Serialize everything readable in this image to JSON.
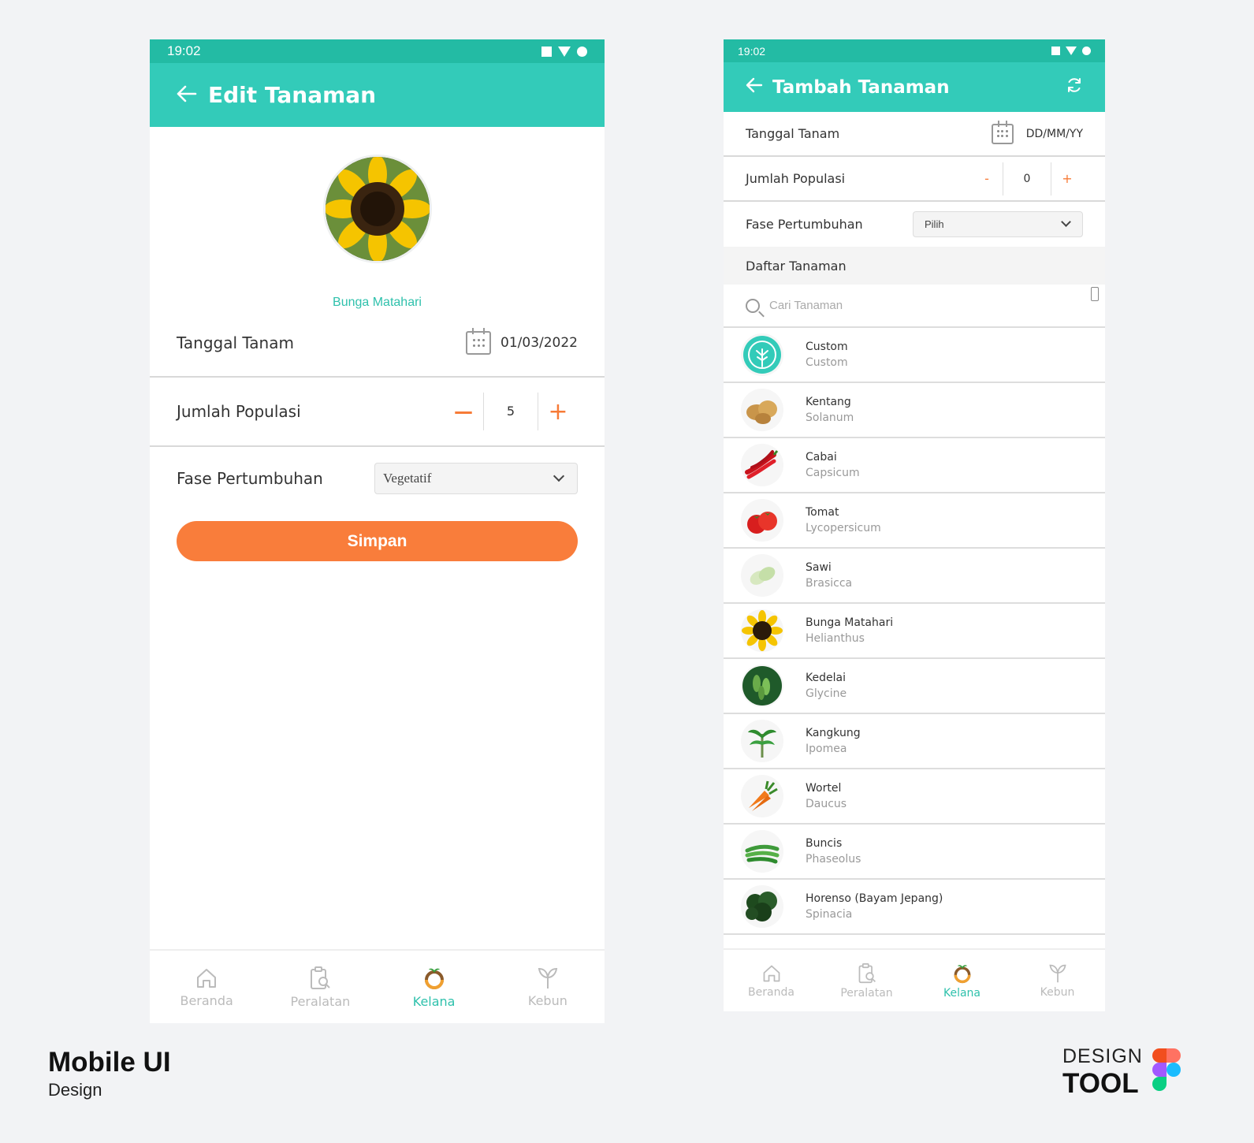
{
  "colors": {
    "teal": "#33cbb9",
    "teal_dark": "#23bba4",
    "orange": "#f97d3b",
    "accent_text": "#2fc1ac"
  },
  "edit_screen": {
    "status_time": "19:02",
    "title": "Edit Tanaman",
    "plant_name": "Bunga Matahari",
    "tanggal_label": "Tanggal Tanam",
    "tanggal_value": "01/03/2022",
    "populasi_label": "Jumlah Populasi",
    "populasi_minus": "—",
    "populasi_value": "5",
    "populasi_plus": "+",
    "fase_label": "Fase Pertumbuhan",
    "fase_value": "Vegetatif",
    "save_label": "Simpan"
  },
  "add_screen": {
    "status_time": "19:02",
    "title": "Tambah Tanaman",
    "tanggal_label": "Tanggal Tanam",
    "tanggal_placeholder": "DD/MM/YY",
    "populasi_label": "Jumlah Populasi",
    "populasi_minus": "-",
    "populasi_value": "0",
    "populasi_plus": "+",
    "fase_label": "Fase Pertumbuhan",
    "fase_value": "Pilih",
    "list_header": "Daftar Tanaman",
    "search_placeholder": "Cari Tanaman",
    "plants": [
      {
        "name": "Custom",
        "latin": "Custom",
        "icon": "custom-tree-icon"
      },
      {
        "name": "Kentang",
        "latin": "Solanum",
        "icon": "potato-icon"
      },
      {
        "name": "Cabai",
        "latin": "Capsicum",
        "icon": "chili-icon"
      },
      {
        "name": "Tomat",
        "latin": "Lycopersicum",
        "icon": "tomato-icon"
      },
      {
        "name": "Sawi",
        "latin": "Brasicca",
        "icon": "mustard-greens-icon"
      },
      {
        "name": "Bunga Matahari",
        "latin": "Helianthus",
        "icon": "sunflower-icon"
      },
      {
        "name": "Kedelai",
        "latin": "Glycine",
        "icon": "soybean-icon"
      },
      {
        "name": "Kangkung",
        "latin": "Ipomea",
        "icon": "water-spinach-icon"
      },
      {
        "name": "Wortel",
        "latin": "Daucus",
        "icon": "carrot-icon"
      },
      {
        "name": "Buncis",
        "latin": "Phaseolus",
        "icon": "green-bean-icon"
      },
      {
        "name": "Horenso (Bayam Jepang)",
        "latin": "Spinacia",
        "icon": "spinach-icon"
      }
    ]
  },
  "nav": {
    "beranda": "Beranda",
    "peralatan": "Peralatan",
    "kelana": "Kelana",
    "kebun": "Kebun"
  },
  "branding": {
    "title": "Mobile UI",
    "subtitle": "Design",
    "tool_top": "DESIGN",
    "tool_bottom": "TOOL"
  }
}
